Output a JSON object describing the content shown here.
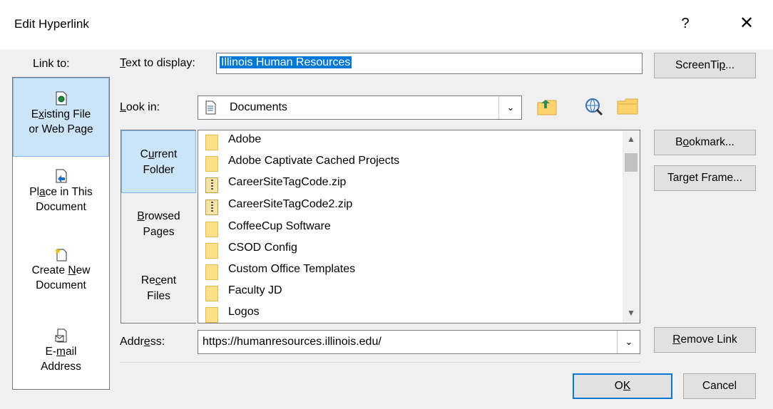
{
  "window": {
    "title": "Edit Hyperlink",
    "help_glyph": "?",
    "close_glyph": "✕"
  },
  "link_to": {
    "title": "Link to:",
    "items": [
      {
        "icon": "web-page-file-icon",
        "pre": "E",
        "u": "x",
        "post": "isting File",
        "line2": "or Web Page",
        "selected": true
      },
      {
        "icon": "place-in-document-icon",
        "pre": "Pl",
        "u": "a",
        "post": "ce in This",
        "line2": "Document",
        "selected": false
      },
      {
        "icon": "new-document-icon",
        "pre": "Create ",
        "u": "N",
        "post": "ew",
        "line2": "Document",
        "selected": false
      },
      {
        "icon": "email-address-icon",
        "pre": "E-",
        "u": "m",
        "post": "ail",
        "line2": "Address",
        "selected": false
      }
    ]
  },
  "text_to_display": {
    "label_u": "T",
    "label_rest": "ext to display:",
    "value": "Illinois Human Resources"
  },
  "screentip": {
    "pre": "ScreenTi",
    "u": "p",
    "post": "..."
  },
  "look_in": {
    "label_u": "L",
    "label_rest": "ook in:",
    "value": "Documents"
  },
  "toolbar_icons": [
    "up-one-folder-icon",
    "browse-web-icon",
    "browse-file-icon"
  ],
  "places": [
    {
      "pre": "C",
      "u": "u",
      "post": "rrent",
      "line2": "Folder",
      "selected": true
    },
    {
      "pre": "",
      "u": "B",
      "post": "rowsed",
      "line2": "Pages",
      "selected": false
    },
    {
      "pre": "Re",
      "u": "c",
      "post": "ent",
      "line2": "Files",
      "selected": false
    }
  ],
  "files": [
    {
      "name": "Adobe",
      "type": "folder"
    },
    {
      "name": "Adobe Captivate Cached Projects",
      "type": "folder"
    },
    {
      "name": "CareerSiteTagCode.zip",
      "type": "zip"
    },
    {
      "name": "CareerSiteTagCode2.zip",
      "type": "zip"
    },
    {
      "name": "CoffeeCup Software",
      "type": "folder"
    },
    {
      "name": "CSOD Config",
      "type": "folder"
    },
    {
      "name": "Custom Office Templates",
      "type": "folder"
    },
    {
      "name": "Faculty JD",
      "type": "folder"
    },
    {
      "name": "Logos",
      "type": "folder"
    }
  ],
  "bookmark": {
    "pre": "B",
    "u": "o",
    "post": "okmark..."
  },
  "target_frame": {
    "pre": "Tar",
    "u": "g",
    "post": "et Frame..."
  },
  "address": {
    "label_pre": "Addr",
    "label_u": "e",
    "label_post": "ss:",
    "value": "https://humanresources.illinois.edu/"
  },
  "remove_link": {
    "pre": "",
    "u": "R",
    "post": "emove Link"
  },
  "ok": {
    "pre": "O",
    "u": "K",
    "post": ""
  },
  "cancel": {
    "label": "Cancel"
  },
  "colors": {
    "selection_highlight": "#0078d7",
    "selected_item_bg": "#cce4f7",
    "folder_yellow": "#ffe08a"
  }
}
